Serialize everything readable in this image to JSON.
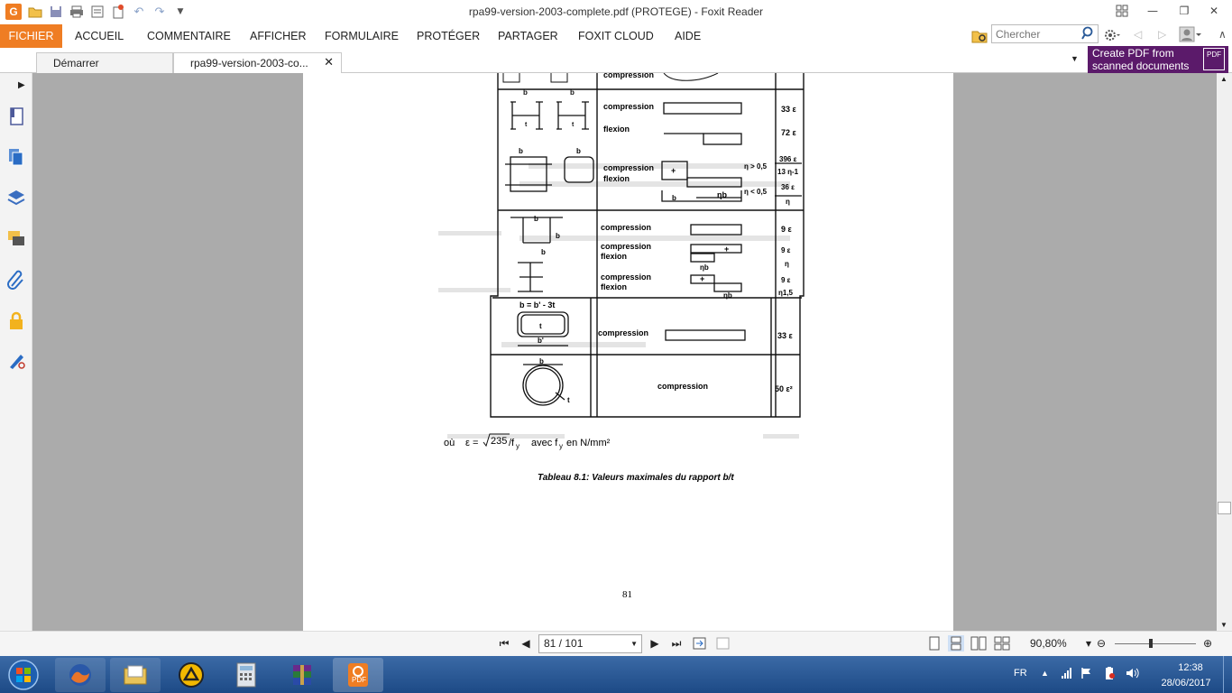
{
  "window": {
    "title": "rpa99-version-2003-complete.pdf (PROTEGE) - Foxit Reader"
  },
  "menu": {
    "items": [
      "FICHIER",
      "ACCUEIL",
      "COMMENTAIRE",
      "AFFICHER",
      "FORMULAIRE",
      "PROTÉGER",
      "PARTAGER",
      "FOXIT CLOUD",
      "AIDE"
    ]
  },
  "search": {
    "placeholder": "Chercher"
  },
  "tabs": [
    {
      "label": "Démarrer"
    },
    {
      "label": "rpa99-version-2003-co..."
    }
  ],
  "promo": {
    "line1": "Create PDF from",
    "line2": "scanned documents",
    "badge": "PDF"
  },
  "document": {
    "table_rows": [
      {
        "cases": [
          "compression"
        ],
        "limits": []
      },
      {
        "cases": [
          "compression",
          "flexion"
        ],
        "limits": [
          "33 ε",
          "72 ε"
        ]
      },
      {
        "cases": [
          "compression",
          "flexion"
        ],
        "limits": [
          "396 ε",
          "13 η-1",
          "36 ε",
          "η"
        ],
        "conditions": [
          "η > 0,5",
          "η < 0,5"
        ]
      },
      {
        "cases": [
          "compression",
          "compression",
          "flexion",
          "compression",
          "flexion"
        ],
        "limits": [
          "9 ε",
          "9 ε",
          "η",
          "9 ε",
          "η1,5"
        ]
      },
      {
        "cases": [
          "compression"
        ],
        "limits": [
          "33 ε"
        ],
        "note": "b = b' - 3t"
      },
      {
        "cases": [
          "compression"
        ],
        "limits": [
          "50 ε²"
        ]
      }
    ],
    "formula": {
      "prefix": "où",
      "eps": "ε =",
      "root": "235",
      "over": "/f",
      "sub": "y",
      "tail": "avec f",
      "tail_sub": "y",
      "unit": "en N/mm²"
    },
    "caption": "Tableau 8.1: Valeurs maximales du rapport b/t",
    "page_number": "81"
  },
  "navigation": {
    "page_field": "81 / 101",
    "zoom": "90,80%"
  },
  "taskbar": {
    "language": "FR",
    "time": "12:38",
    "date": "28/06/2017"
  },
  "colors": {
    "accent": "#ef7d23",
    "promo_bg": "#5b1a6a",
    "doc_bg": "#ababab",
    "taskbar": "#2a5a98"
  }
}
